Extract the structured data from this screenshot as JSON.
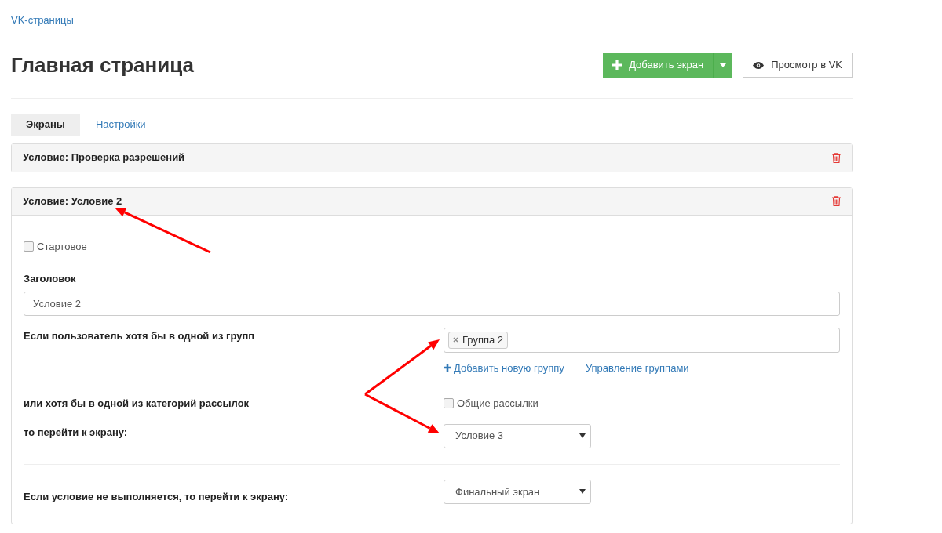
{
  "breadcrumb": "VK-страницы",
  "title": "Главная страница",
  "add_button": {
    "label": "Добавить экран"
  },
  "view_button": {
    "label": "Просмотр в VK"
  },
  "tabs": [
    {
      "label": "Экраны",
      "selected": true
    },
    {
      "label": "Настройки",
      "selected": false
    }
  ],
  "panels": [
    {
      "title": "Условие: Проверка разрешений",
      "expanded": false
    },
    {
      "title": "Условие: Условие 2",
      "expanded": true,
      "form": {
        "start_checkbox": {
          "label": "Стартовое",
          "checked": false
        },
        "title_field": {
          "label": "Заголовок",
          "value": "Условие 2"
        },
        "groups": {
          "label": "Если пользователь хотя бы в одной из групп",
          "tags": [
            "Группа 2"
          ],
          "add_link": "Добавить новую группу",
          "manage_link": "Управление группами"
        },
        "mailing": {
          "label": "или хотя бы в одной из категорий рассылок",
          "option": {
            "label": "Общие рассылки",
            "checked": false
          }
        },
        "goto": {
          "label": "то перейти к экрану:",
          "value": "Условие 3"
        },
        "fallback": {
          "label": "Если условие не выполняется, то перейти к экрану:",
          "value": "Финальный экран"
        }
      }
    }
  ]
}
